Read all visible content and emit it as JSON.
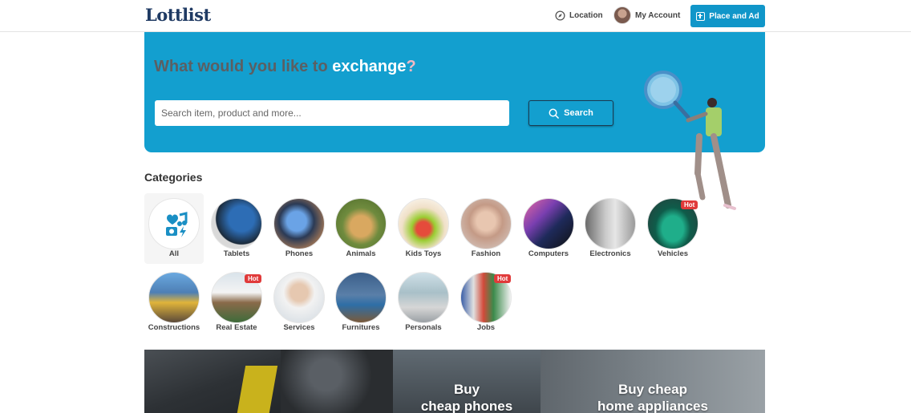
{
  "header": {
    "logo": "Lottlist",
    "location_label": "Location",
    "account_label": "My Account",
    "place_ad_label": "Place and Ad"
  },
  "hero": {
    "title_prefix": "What would you like to ",
    "title_highlight": "exchange",
    "title_suffix": "?",
    "search_placeholder": "Search item, product and more...",
    "search_value": "",
    "search_button": "Search"
  },
  "categories": {
    "title": "Categories",
    "hot_badge": "Hot",
    "items": [
      {
        "label": "All",
        "hot": false,
        "selected": true
      },
      {
        "label": "Tablets",
        "hot": false
      },
      {
        "label": "Phones",
        "hot": false
      },
      {
        "label": "Animals",
        "hot": false
      },
      {
        "label": "Kids Toys",
        "hot": false
      },
      {
        "label": "Fashion",
        "hot": false
      },
      {
        "label": "Computers",
        "hot": false
      },
      {
        "label": "Electronics",
        "hot": false
      },
      {
        "label": "Vehicles",
        "hot": true
      },
      {
        "label": "Constructions",
        "hot": false
      },
      {
        "label": "Real Estate",
        "hot": true
      },
      {
        "label": "Services",
        "hot": false
      },
      {
        "label": "Furnitures",
        "hot": false
      },
      {
        "label": "Personals",
        "hot": false
      },
      {
        "label": "Jobs",
        "hot": true
      }
    ]
  },
  "banners": {
    "phones_line1": "Buy",
    "phones_line2": "cheap phones",
    "appliances_line1": "Buy cheap",
    "appliances_line2": "home appliances"
  },
  "colors": {
    "brand": "#139fcf",
    "hot": "#e03a3a",
    "title_grey": "#5b5f63"
  }
}
